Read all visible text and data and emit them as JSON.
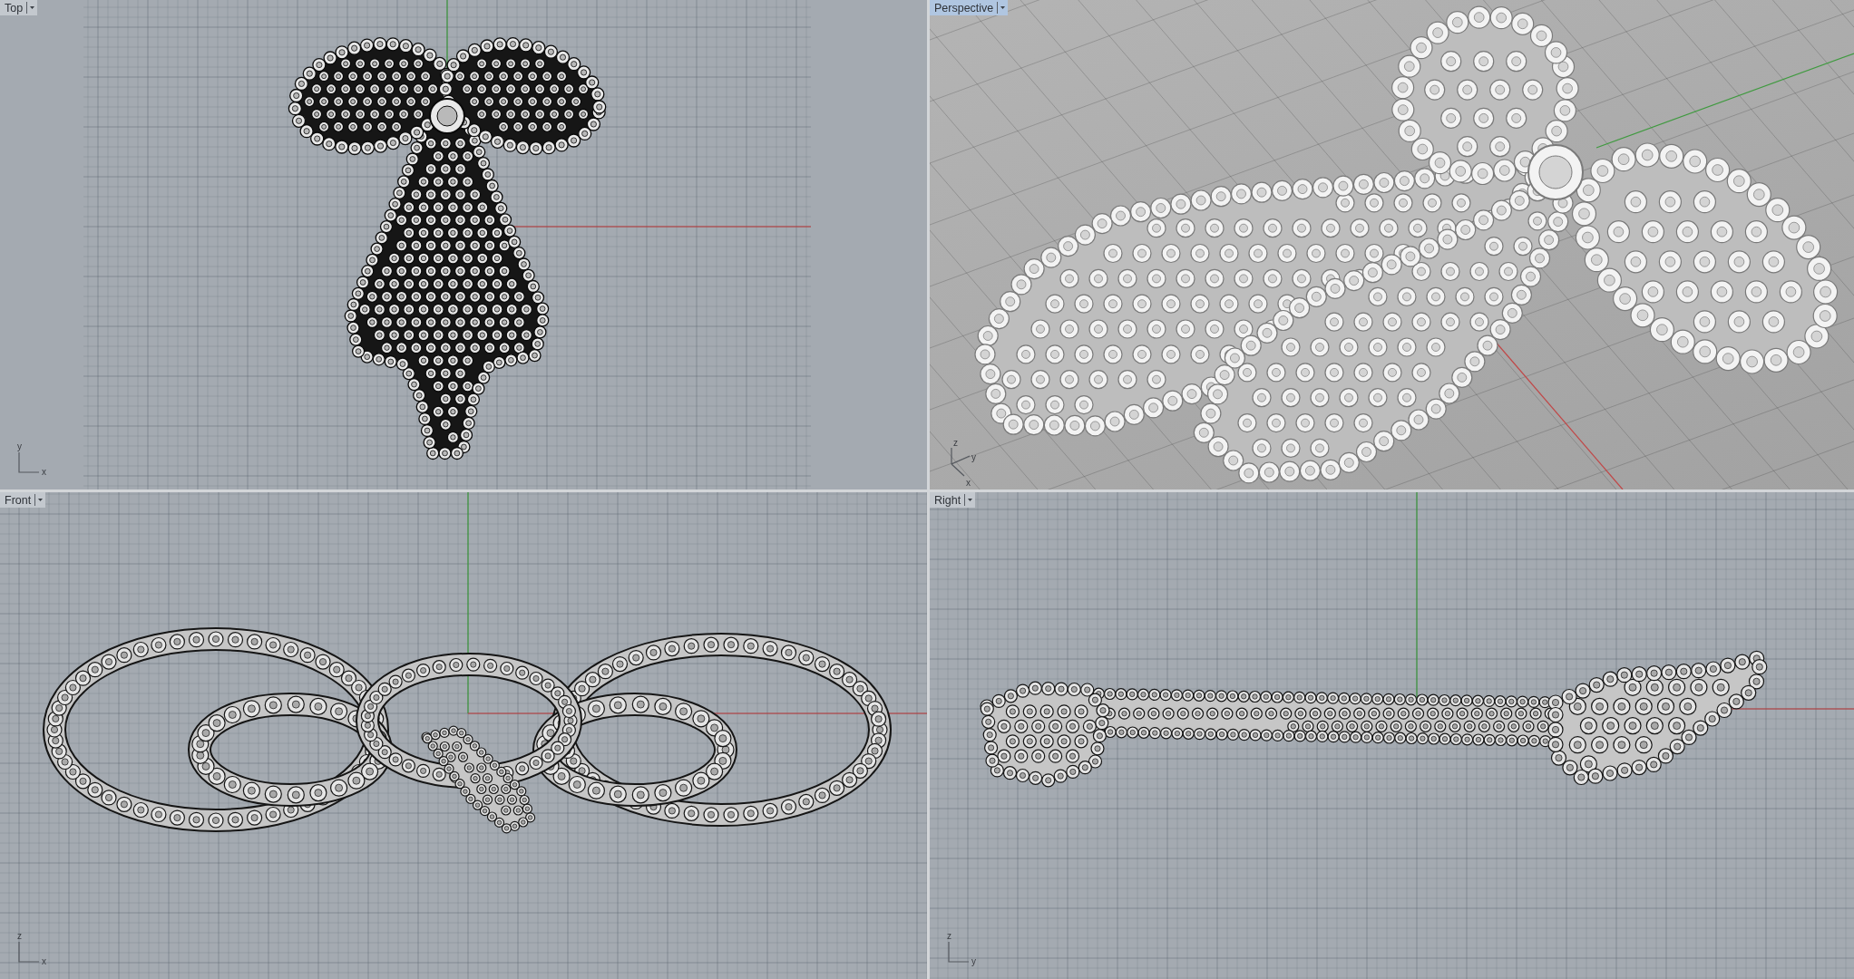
{
  "viewports": [
    {
      "title": "Top",
      "kind": "top",
      "selected": false,
      "axis_labels": [
        {
          "text": "y",
          "kind": "up"
        },
        {
          "text": "x",
          "kind": "right"
        }
      ]
    },
    {
      "title": "Perspective",
      "kind": "perspective",
      "selected": true,
      "axis_labels": [
        {
          "text": "z",
          "kind": "up"
        },
        {
          "text": "y",
          "kind": "upright"
        },
        {
          "text": "x",
          "kind": "downright"
        }
      ]
    },
    {
      "title": "Front",
      "kind": "front",
      "selected": false,
      "axis_labels": [
        {
          "text": "z",
          "kind": "up"
        },
        {
          "text": "x",
          "kind": "right"
        }
      ]
    },
    {
      "title": "Right",
      "kind": "right",
      "selected": false,
      "axis_labels": [
        {
          "text": "z",
          "kind": "up"
        },
        {
          "text": "y",
          "kind": "right"
        }
      ]
    }
  ]
}
